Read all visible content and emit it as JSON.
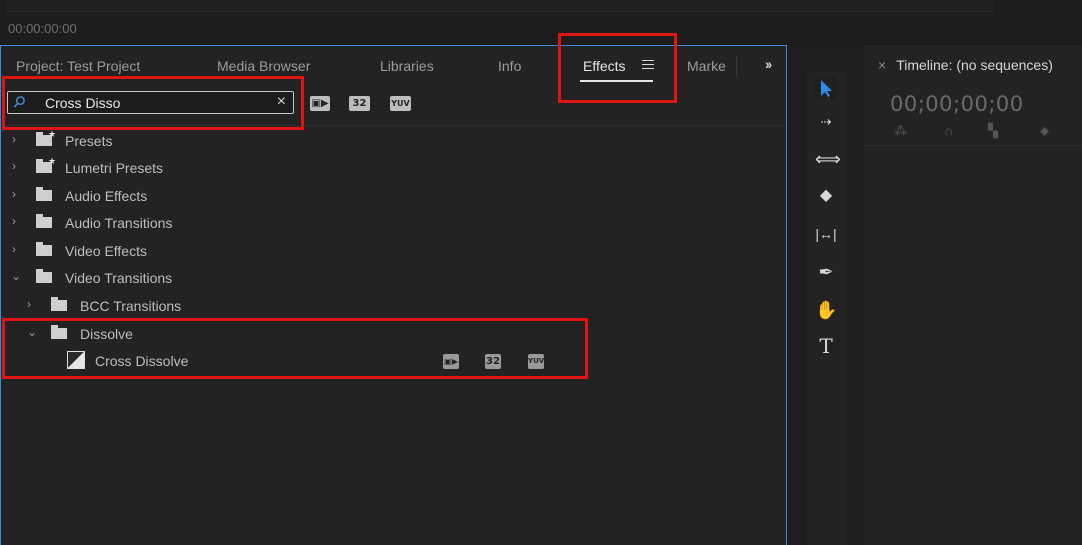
{
  "monitor": {
    "timecode": "00:00:00:00"
  },
  "tabs": [
    {
      "label": "Project: Test Project"
    },
    {
      "label": "Media Browser"
    },
    {
      "label": "Libraries"
    },
    {
      "label": "Info"
    },
    {
      "label": "Effects"
    },
    {
      "label": "Marke"
    }
  ],
  "search": {
    "value": "Cross Disso",
    "clear_glyph": "×"
  },
  "filter_badges": [
    "32",
    "YUV"
  ],
  "tree": {
    "presets": "Presets",
    "lumetri_presets": "Lumetri Presets",
    "audio_effects": "Audio Effects",
    "audio_transitions": "Audio Transitions",
    "video_effects": "Video Effects",
    "video_transitions": "Video Transitions",
    "bcc_transitions": "BCC Transitions",
    "dissolve": "Dissolve",
    "cross_dissolve": "Cross Dissolve"
  },
  "timeline": {
    "close_glyph": "×",
    "title": "Timeline: (no sequences)",
    "timecode": "00;00;00;00"
  },
  "tools": [
    "selection-tool",
    "track-select-tool",
    "ripple-edit-tool",
    "razor-tool",
    "slip-tool",
    "pen-tool",
    "hand-tool",
    "type-tool"
  ],
  "colors": {
    "accent": "#2d8ceb",
    "highlight": "#e11414",
    "panel_border": "#3f8bd6"
  }
}
